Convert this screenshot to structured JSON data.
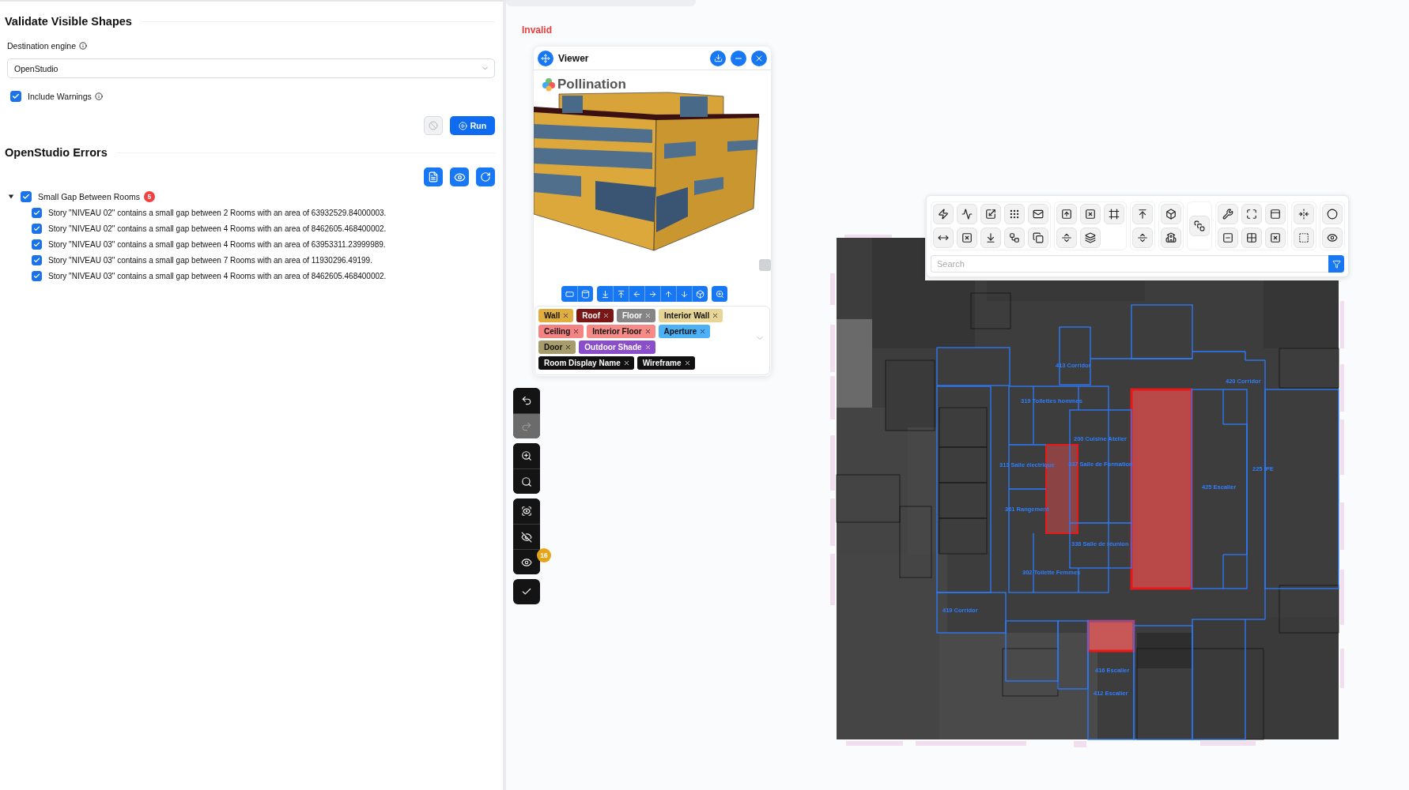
{
  "validate": {
    "title": "Validate Visible Shapes",
    "engine": {
      "label": "Destination engine",
      "value": "OpenStudio"
    },
    "include_warnings": {
      "label": "Include Warnings",
      "checked": true
    },
    "stop_button": {
      "disabled": true
    },
    "run_button": {
      "label": "Run"
    }
  },
  "errors": {
    "title": "OpenStudio Errors",
    "groups": [
      {
        "label": "Small Gap Between Rooms",
        "count": "5",
        "checked": true,
        "expanded": true,
        "items": [
          {
            "text": "Story \"NIVEAU 02\" contains a small gap between 2 Rooms with an area of 63932529.84000003.",
            "checked": true
          },
          {
            "text": "Story \"NIVEAU 02\" contains a small gap between 4 Rooms with an area of 8462605.468400002.",
            "checked": true
          },
          {
            "text": "Story \"NIVEAU 03\" contains a small gap between 4 Rooms with an area of 63953311.23999989.",
            "checked": true
          },
          {
            "text": "Story \"NIVEAU 03\" contains a small gap between 7 Rooms with an area of 11930296.49199.",
            "checked": true
          },
          {
            "text": "Story \"NIVEAU 03\" contains a small gap between 4 Rooms with an area of 8462605.468400002.",
            "checked": true
          }
        ]
      }
    ]
  },
  "canvas": {
    "status": "Invalid"
  },
  "viewer": {
    "title": "Viewer",
    "logo": "Pollination",
    "tags": [
      {
        "label": "Wall",
        "color": "#dfae3e"
      },
      {
        "label": "Roof",
        "color": "#7b1616"
      },
      {
        "label": "Floor",
        "color": "#858585"
      },
      {
        "label": "Interior Wall",
        "color": "#e6d596"
      },
      {
        "label": "Ceiling",
        "color": "#f48383"
      },
      {
        "label": "Interior Floor",
        "color": "#f68a86"
      },
      {
        "label": "Aperture",
        "color": "#4cb2f7"
      },
      {
        "label": "Door",
        "color": "#a79c6b"
      },
      {
        "label": "Outdoor Shade",
        "color": "#8a4dcc"
      },
      {
        "label": "Room Display Name",
        "color": "#111111"
      },
      {
        "label": "Wireframe",
        "color": "#111111"
      }
    ]
  },
  "side_tools": {
    "badge": "16",
    "groups": [
      {
        "buttons": [
          {
            "kind": "undo",
            "disabled": false
          },
          {
            "kind": "redo",
            "disabled": true
          }
        ]
      },
      {
        "buttons": [
          {
            "kind": "zoom-in",
            "disabled": false
          },
          {
            "kind": "search",
            "disabled": false
          }
        ]
      },
      {
        "buttons": [
          {
            "kind": "focus",
            "disabled": false
          },
          {
            "kind": "hide",
            "disabled": false
          },
          {
            "kind": "show",
            "disabled": false
          }
        ]
      },
      {
        "buttons": [
          {
            "kind": "confirm",
            "disabled": false
          }
        ]
      }
    ]
  },
  "plan_toolbar": {
    "search": {
      "placeholder": "Search"
    }
  },
  "plan": {
    "rooms": [
      {
        "label": "413 Corridor"
      },
      {
        "label": "420 Corridor"
      },
      {
        "label": "319 Toilettes hommes"
      },
      {
        "label": "200 Cuisine Atelier"
      },
      {
        "label": "313 Salle électrique"
      },
      {
        "label": "337 Salle de Formation"
      },
      {
        "label": "225 IPE"
      },
      {
        "label": "425 Escalier"
      },
      {
        "label": "361 Rangement"
      },
      {
        "label": "338 Salle de réunion"
      },
      {
        "label": "302 Toilette Femmes"
      },
      {
        "label": "419 Corridor"
      },
      {
        "label": "416 Escalier"
      },
      {
        "label": "412 Escalier"
      }
    ]
  }
}
